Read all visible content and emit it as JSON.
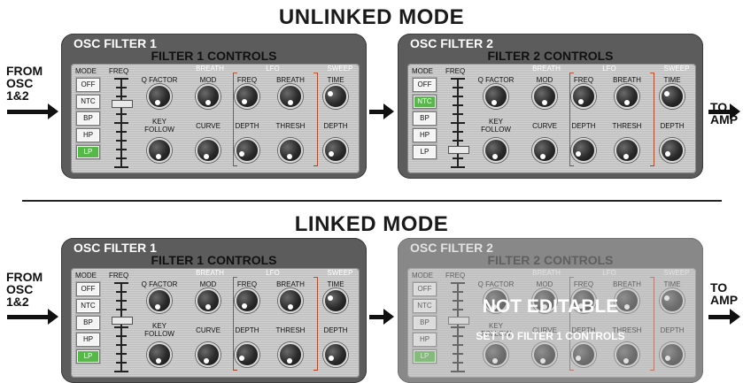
{
  "titles": {
    "unlinked": "UNLINKED MODE",
    "linked": "LINKED MODE"
  },
  "io": {
    "from": [
      "FROM",
      "OSC",
      "1&2"
    ],
    "to": [
      "TO",
      "AMP"
    ]
  },
  "filter1": {
    "title": "OSC FILTER 1",
    "controls": "FILTER 1 CONTROLS"
  },
  "filter2": {
    "title": "OSC FILTER 2",
    "controls": "FILTER 2 CONTROLS"
  },
  "labels": {
    "mode": "MODE",
    "freq": "FREQ",
    "breath_section": "BREATH",
    "lfo_section": "LFO",
    "sweep_section": "SWEEP",
    "q_factor": "Q FACTOR",
    "mod": "MOD",
    "lfo_freq": "FREQ",
    "lfo_breath": "BREATH",
    "time": "TIME",
    "key_follow": [
      "KEY",
      "FOLLOW"
    ],
    "curve": "CURVE",
    "depth": "DEPTH",
    "thresh": "THRESH",
    "sweep_depth": "DEPTH"
  },
  "mode_options": [
    "OFF",
    "NTC",
    "BP",
    "HP",
    "LP"
  ],
  "panels": [
    {
      "filter": "filter1",
      "active_mode": "LP",
      "freq_level": 0.72,
      "editable": true
    },
    {
      "filter": "filter2",
      "active_mode": "NTC",
      "freq_level": 0.2,
      "editable": true
    },
    {
      "filter": "filter1",
      "active_mode": "LP",
      "freq_level": 0.58,
      "editable": true
    },
    {
      "filter": "filter2",
      "active_mode": "LP",
      "freq_level": 0.58,
      "editable": false
    }
  ],
  "overlay": {
    "title": "NOT EDITABLE",
    "subtitle": "SET TO FILTER 1 CONTROLS"
  },
  "colors": {
    "active_mode": "#55b848",
    "lfo_bracket": "#b24a2a",
    "panel": "#5c5c5c"
  }
}
